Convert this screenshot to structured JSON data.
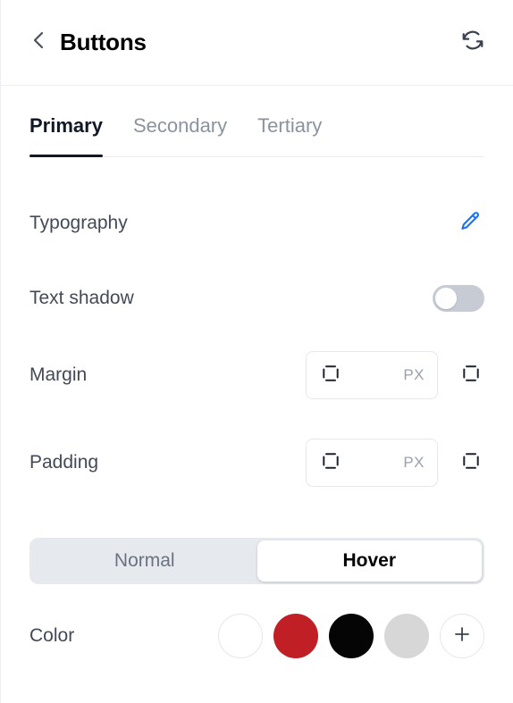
{
  "header": {
    "back_icon": "chevron-left-icon",
    "title": "Buttons",
    "refresh_icon": "refresh-icon"
  },
  "tabs": [
    {
      "label": "Primary",
      "active": true
    },
    {
      "label": "Secondary",
      "active": false
    },
    {
      "label": "Tertiary",
      "active": false
    }
  ],
  "rows": {
    "typography": {
      "label": "Typography",
      "edit_icon": "pencil-icon"
    },
    "text_shadow": {
      "label": "Text shadow",
      "toggle_state": "off"
    },
    "margin": {
      "label": "Margin",
      "value": "",
      "placeholder": "",
      "unit": "PX",
      "box_icon": "spacing-box-icon",
      "link_icon": "link-sides-icon"
    },
    "padding": {
      "label": "Padding",
      "value": "",
      "placeholder": "",
      "unit": "PX",
      "box_icon": "spacing-box-icon",
      "link_icon": "link-sides-icon"
    },
    "color": {
      "label": "Color"
    }
  },
  "state_switcher": {
    "options": [
      {
        "label": "Normal",
        "active": false
      },
      {
        "label": "Hover",
        "active": true
      }
    ]
  },
  "color_swatches": [
    {
      "name": "white",
      "hex": "#ffffff",
      "bordered": true
    },
    {
      "name": "red",
      "hex": "#c01f26",
      "bordered": false
    },
    {
      "name": "black",
      "hex": "#050505",
      "bordered": false
    },
    {
      "name": "light-gray",
      "hex": "#d7d7d7",
      "bordered": false
    }
  ],
  "add_color": {
    "icon": "plus-icon"
  },
  "colors": {
    "accent_blue": "#2563eb",
    "title": "#000000",
    "label": "#434a57",
    "muted": "#8b93a1",
    "border": "#e6e8ec",
    "track": "#e6e9ee"
  }
}
